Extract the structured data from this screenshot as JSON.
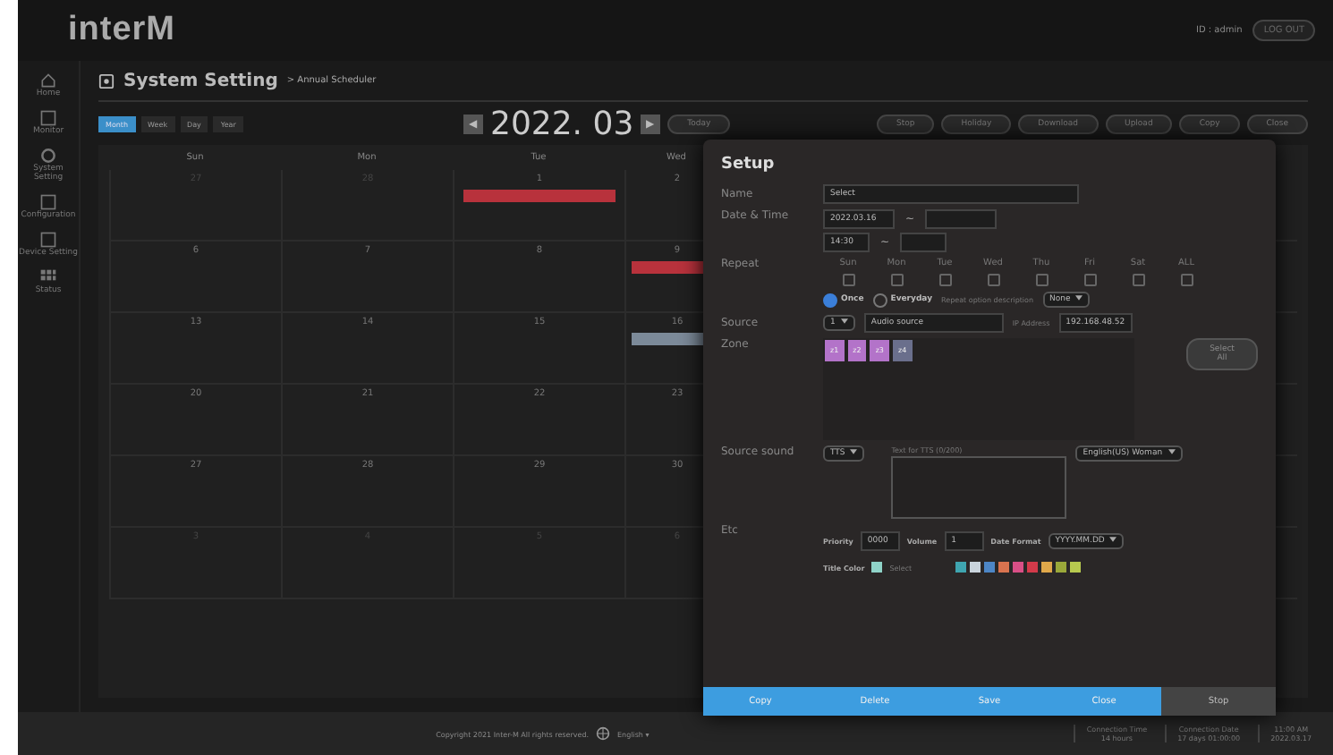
{
  "header": {
    "logo": "interM",
    "user": "ID : admin",
    "logout": "LOG OUT"
  },
  "sidebar": {
    "items": [
      {
        "kind": "home",
        "label": "Home"
      },
      {
        "kind": "monitor",
        "label": "Monitor"
      },
      {
        "kind": "setting",
        "label": "System Setting"
      },
      {
        "kind": "config",
        "label": "Configuration"
      },
      {
        "kind": "device",
        "label": "Device Setting"
      },
      {
        "kind": "grid",
        "label": "Status"
      }
    ]
  },
  "page": {
    "title": "System Setting",
    "breadcrumb": "> Annual Scheduler"
  },
  "views": [
    {
      "label": "Month",
      "selected": true
    },
    {
      "label": "Week",
      "selected": false
    },
    {
      "label": "Day",
      "selected": false
    },
    {
      "label": "Year",
      "selected": false
    }
  ],
  "month": {
    "prev": "◀",
    "label": "2022. 03",
    "next": "▶",
    "today": "Today"
  },
  "actions": [
    "Stop",
    "Holiday",
    "Download",
    "Upload",
    "Copy",
    "Close"
  ],
  "calendar": {
    "columns": [
      "Sun",
      "Mon",
      "Tue",
      "Wed"
    ],
    "weeks": [
      [
        {
          "day": "27",
          "other": true
        },
        {
          "day": "28",
          "other": true
        },
        {
          "day": "1",
          "other": false,
          "event": {
            "color": "#b8323c"
          }
        },
        {
          "day": "2",
          "other": false
        }
      ],
      [
        {
          "day": "6",
          "other": false
        },
        {
          "day": "7",
          "other": false
        },
        {
          "day": "8",
          "other": false
        },
        {
          "day": "9",
          "other": false,
          "event": {
            "color": "#b8323c"
          }
        }
      ],
      [
        {
          "day": "13",
          "other": false
        },
        {
          "day": "14",
          "other": false
        },
        {
          "day": "15",
          "other": false
        },
        {
          "day": "16",
          "other": false,
          "event": {
            "color": "#7c8a99"
          }
        }
      ],
      [
        {
          "day": "20",
          "other": false
        },
        {
          "day": "21",
          "other": false
        },
        {
          "day": "22",
          "other": false
        },
        {
          "day": "23",
          "other": false
        }
      ],
      [
        {
          "day": "27",
          "other": false
        },
        {
          "day": "28",
          "other": false
        },
        {
          "day": "29",
          "other": false
        },
        {
          "day": "30",
          "other": false
        }
      ],
      [
        {
          "day": "3",
          "other": true
        },
        {
          "day": "4",
          "other": true
        },
        {
          "day": "5",
          "other": true
        },
        {
          "day": "6",
          "other": true
        }
      ]
    ]
  },
  "dialog": {
    "title": "Setup",
    "name": {
      "label": "Name",
      "value": "Select"
    },
    "datetime": {
      "label": "Date & Time",
      "start_date": "2022.03.16",
      "start_time": "14:30",
      "tilde_1": "~",
      "tilde_2": "~"
    },
    "repeat": {
      "label": "Repeat",
      "days": [
        {
          "label": "Sun",
          "checked": false
        },
        {
          "label": "Mon",
          "checked": false
        },
        {
          "label": "Tue",
          "checked": false
        },
        {
          "label": "Wed",
          "checked": false
        },
        {
          "label": "Thu",
          "checked": false
        },
        {
          "label": "Fri",
          "checked": false
        },
        {
          "label": "Sat",
          "checked": false
        },
        {
          "label": "ALL",
          "checked": false
        }
      ],
      "modes": [
        {
          "label": "Once",
          "selected": true
        },
        {
          "label": "Everyday",
          "selected": false
        }
      ],
      "option_label": "Repeat option description",
      "option_value": "None"
    },
    "source": {
      "label": "Source",
      "number": "1",
      "name": "Audio source",
      "ip_label": "IP Address",
      "ip": "192.168.48.52"
    },
    "zone": {
      "label": "Zone",
      "chips": [
        {
          "label": "z1",
          "selected": true
        },
        {
          "label": "z2",
          "selected": true
        },
        {
          "label": "z3",
          "selected": true
        },
        {
          "label": "z4",
          "selected": false
        }
      ],
      "select_all": "Select All"
    },
    "sound": {
      "label": "Source sound",
      "type": "TTS",
      "text_label": "Text for TTS (0/200)",
      "language": "English(US) Woman"
    },
    "etc": {
      "label": "Etc",
      "priority_label": "Priority",
      "priority": "0000",
      "volume_label": "Volume",
      "volume": "1",
      "format_label": "Date Format",
      "format": "YYYY.MM.DD",
      "color_label": "Title Color",
      "color_select": "Select",
      "palette": [
        {
          "color": "#3fa5b0"
        },
        {
          "color": "#c9d4dc"
        },
        {
          "color": "#4d86c6"
        },
        {
          "color": "#d9734f"
        },
        {
          "color": "#d94f86"
        },
        {
          "color": "#d33a4a"
        },
        {
          "color": "#e0a84a"
        },
        {
          "color": "#9aa83a"
        },
        {
          "color": "#b7c94f"
        }
      ]
    },
    "buttons": [
      {
        "label": "Copy",
        "kind": "primary"
      },
      {
        "label": "Delete",
        "kind": "primary"
      },
      {
        "label": "Save",
        "kind": "primary"
      },
      {
        "label": "Close",
        "kind": "primary"
      },
      {
        "label": "Stop",
        "kind": "secondary"
      }
    ]
  },
  "footer": {
    "copyright": "Copyright 2021 Inter-M All rights reserved.",
    "language": "English ▾",
    "stats": [
      {
        "label": "Connection Time",
        "value": "14 hours"
      },
      {
        "label": "Connection Date",
        "value": "17 days 01:00:00"
      },
      {
        "label": "11:00 AM",
        "value": "2022.03.17"
      }
    ]
  }
}
